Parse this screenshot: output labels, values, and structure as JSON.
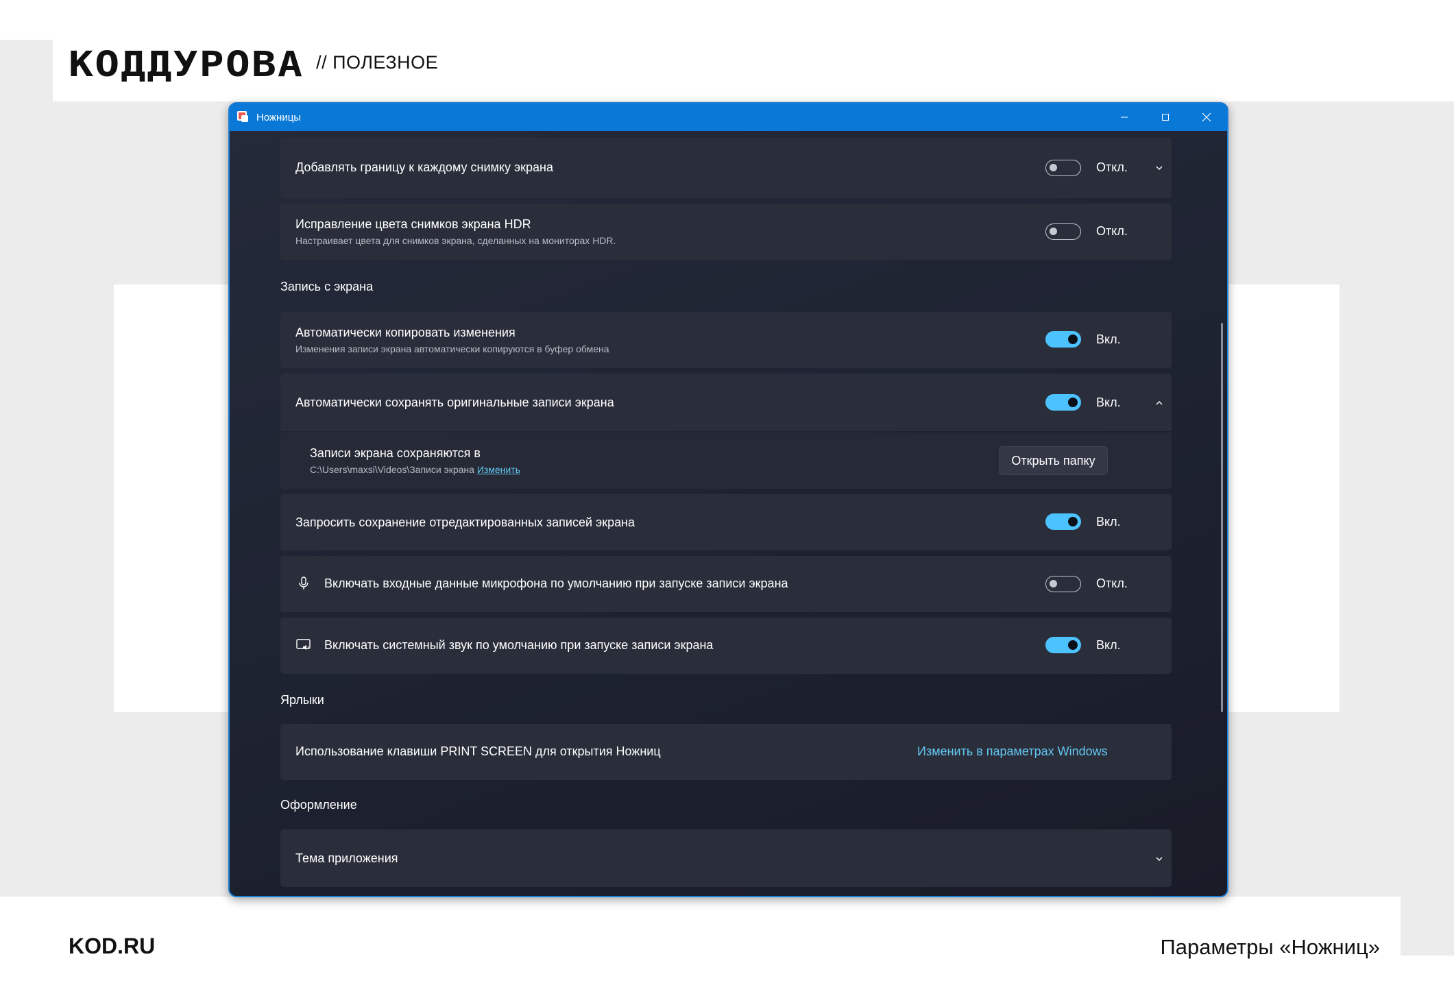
{
  "brand": {
    "logo": "КОДДУРОВА",
    "tag": "// ПОЛЕЗНОЕ"
  },
  "footer": {
    "site": "KOD.RU",
    "caption": "Параметры «Ножниц»"
  },
  "window": {
    "title": "Ножницы",
    "controls": {
      "minimize": "minimize",
      "maximize": "maximize",
      "close": "close"
    }
  },
  "settings": {
    "border": {
      "label": "Добавлять границу к каждому снимку экрана",
      "state": "Откл.",
      "on": false
    },
    "hdr": {
      "label": "Исправление цвета снимков экрана HDR",
      "sub": "Настраивает цвета для снимков экрана, сделанных на мониторах HDR.",
      "state": "Откл.",
      "on": false
    },
    "recording_section": "Запись с экрана",
    "auto_copy": {
      "label": "Автоматически копировать изменения",
      "sub": "Изменения записи экрана автоматически копируются в буфер обмена",
      "state": "Вкл.",
      "on": true
    },
    "auto_save": {
      "label": "Автоматически сохранять оригинальные записи экрана",
      "state": "Вкл.",
      "on": true
    },
    "save_location": {
      "label": "Записи экрана сохраняются в",
      "path": "C:\\Users\\maxsi\\Videos\\Записи экрана",
      "change_link": "Изменить",
      "open_folder": "Открыть папку"
    },
    "ask_save": {
      "label": "Запросить сохранение отредактированных записей экрана",
      "state": "Вкл.",
      "on": true
    },
    "mic": {
      "label": "Включать входные данные микрофона по умолчанию при запуске записи экрана",
      "state": "Откл.",
      "on": false,
      "icon": "microphone-icon"
    },
    "system_audio": {
      "label": "Включать системный звук по умолчанию при запуске записи экрана",
      "state": "Вкл.",
      "on": true,
      "icon": "system-audio-icon"
    },
    "shortcuts_section": "Ярлыки",
    "print_screen": {
      "label": "Использование клавиши PRINT SCREEN для открытия Ножниц",
      "link": "Изменить в параметрах Windows"
    },
    "appearance_section": "Оформление",
    "theme": {
      "label": "Тема приложения"
    }
  },
  "colors": {
    "accent": "#4cc2ff",
    "titlebar": "#0a78d7",
    "card": "#2a2e3b",
    "link": "#63c7f2"
  }
}
